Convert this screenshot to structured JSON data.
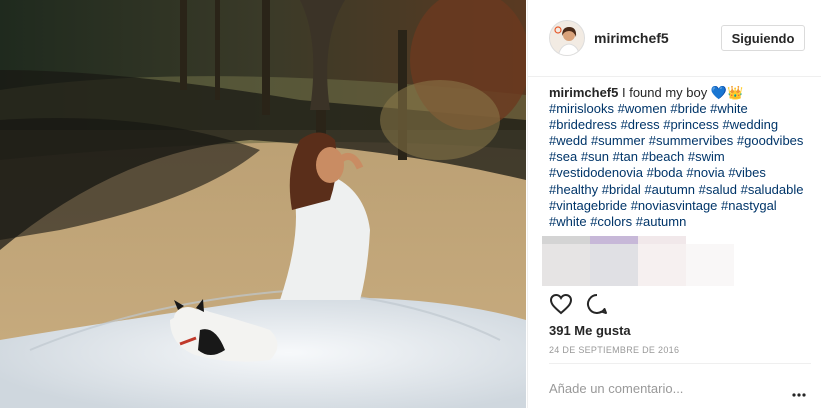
{
  "post": {
    "username": "mirimchef5",
    "follow_label": "Siguiendo",
    "caption_user": "mirimchef5",
    "caption_text": " I found my boy ",
    "caption_emoji": "💙👑",
    "hashtags": [
      "#mirislooks",
      "#women",
      "#bride",
      "#white",
      "#bridedress",
      "#dress",
      "#princess",
      "#wedding",
      "#wedd",
      "#summer",
      "#summervibes",
      "#goodvibes",
      "#sea",
      "#sun",
      "#tan",
      "#beach",
      "#swim",
      "#vestidodenovia",
      "#boda",
      "#novia",
      "#vibes",
      "#healthy",
      "#bridal",
      "#autumn",
      "#salud",
      "#saludable",
      "#vintagebride",
      "#noviasvintage",
      "#nastygal",
      "#white",
      "#colors",
      "#autumn"
    ],
    "likes": "391 Me gusta",
    "date": "24 DE SEPTIEMBRE DE 2016",
    "comment_placeholder": "Añade un comentario..."
  },
  "icons": {
    "like": "heart-icon",
    "comment": "comment-icon",
    "more": "more-options-icon",
    "avatar": "avatar"
  },
  "colors": {
    "hashtag": "#003569",
    "text": "#262626",
    "muted": "#999999",
    "border": "#efefef"
  }
}
